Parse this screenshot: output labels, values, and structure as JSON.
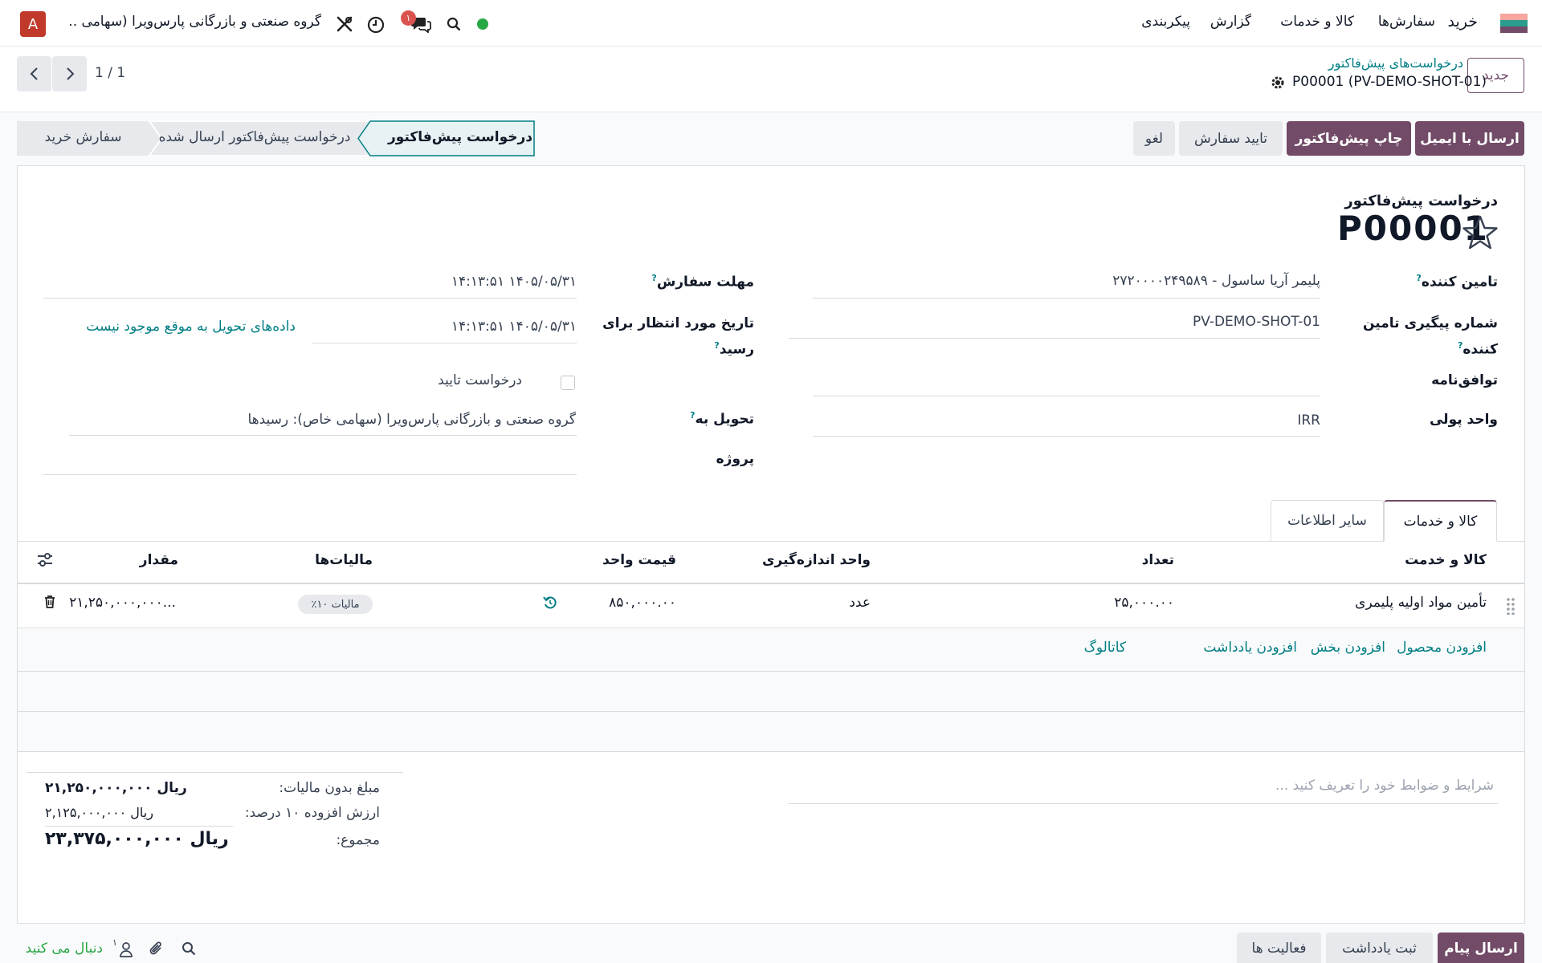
{
  "topbar": {
    "app_name": "خرید",
    "menu": [
      "سفارش‌ها",
      "کالا و خدمات",
      "گزارش",
      "پیکربندی"
    ],
    "company": "گروه صنعتی و بازرگانی پارس‌ویرا (سهامی ...",
    "avatar_letter": "A",
    "notification_count": "۱"
  },
  "control": {
    "new_button": "جدید",
    "breadcrumb_parent": "درخواست‌های پیش‌فاکتور",
    "record_name": "P00001 (PV-DEMO-SHOT-01)",
    "pager": "1 / 1"
  },
  "actions": {
    "send_email": "ارسال با ایمیل",
    "print_rfq": "چاپ پیش‌فاکتور",
    "confirm_order": "تایید سفارش",
    "cancel": "لغو"
  },
  "statusbar": {
    "steps": [
      "درخواست پیش‌فاکتور",
      "درخواست پیش‌فاکتور ارسال شده",
      "سفارش خرید"
    ]
  },
  "form": {
    "doc_type": "درخواست پیش‌فاکتور",
    "doc_number": "P00001",
    "vendor_label": "تامین کننده",
    "vendor_value": "پلیمر آریا ساسول - ۲۷۲۰۰۰۰۲۴۹۵۸۹",
    "vendor_ref_label_1": "شماره پیگیری تامین",
    "vendor_ref_label_2": "کننده",
    "vendor_ref_value": "PV-DEMO-SHOT-01",
    "agreement_label": "توافق‌نامه",
    "currency_label": "واحد پولی",
    "currency_value": "IRR",
    "deadline_label": "مهلت سفارش",
    "deadline_value": "۱۴۰۵/۰۵/۳۱ ۱۴:۱۳:۵۱",
    "expected_label_1": "تاریخ مورد انتظار برای",
    "expected_label_2": "رسید",
    "expected_value": "۱۴۰۵/۰۵/۳۱ ۱۴:۱۳:۵۱",
    "no_delivery_data": "داده‌های تحویل به موقع موجود نیست",
    "ask_confirmation": "درخواست تایید",
    "deliver_to_label": "تحویل به",
    "deliver_to_value": "گروه صنعتی و بازرگانی پارس‌ویرا (سهامی خاص): رسیدها",
    "project_label": "پروژه"
  },
  "tabs": [
    "کالا و خدمات",
    "سایر اطلاعات"
  ],
  "table": {
    "headers": [
      "کالا و خدمت",
      "تعداد",
      "واحد اندازه‌گیری",
      "قیمت واحد",
      "مالیات‌ها",
      "مقدار"
    ],
    "rows": [
      {
        "product": "تأمین مواد اولیه پلیمری",
        "qty": "۲۵,۰۰۰.۰۰",
        "uom": "عدد",
        "price": "۸۵۰,۰۰۰.۰۰",
        "tax": "مالیات ۱۰٪",
        "amount": "۲۱,۲۵۰,۰۰۰,۰۰۰..."
      }
    ],
    "add_links": [
      "افزودن محصول",
      "افزودن بخش",
      "افزودن یادداشت",
      "کاتالوگ"
    ]
  },
  "notes_placeholder": "شرایط و ضوابط خود را تعریف کنید ...",
  "totals": {
    "untaxed_label": "مبلغ بدون مالیات:",
    "untaxed_value": "ریال ۲۱,۲۵۰,۰۰۰,۰۰۰",
    "vat_label": "ارزش افزوده ۱۰ درصد:",
    "vat_value": "ریال ۲,۱۲۵,۰۰۰,۰۰۰",
    "total_label": "مجموع:",
    "total_value": "ریال ۲۳,۳۷۵,۰۰۰,۰۰۰"
  },
  "chatter": {
    "send_message": "ارسال پیام",
    "log_note": "ثبت یادداشت",
    "activities": "فعالیت ها",
    "follow": "دنبال می کنید",
    "followers_count": "۱"
  },
  "colors": {
    "brand": "#714b67",
    "link": "#017e84",
    "online": "#28a745",
    "badge": "#d9534f"
  }
}
